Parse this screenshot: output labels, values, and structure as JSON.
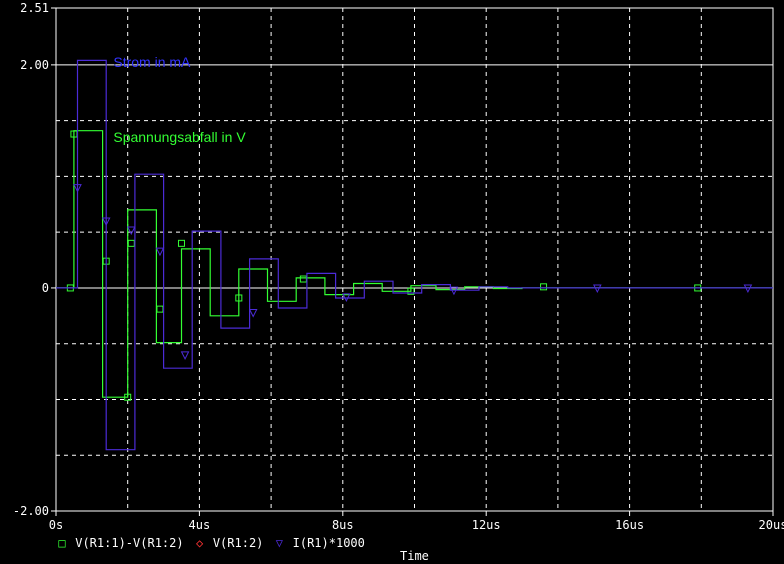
{
  "chart_data": {
    "type": "line",
    "xlabel": "Time",
    "x_unit": "us",
    "xlim": [
      0,
      20
    ],
    "ylim": [
      -2.0,
      2.51
    ],
    "x_ticks": [
      {
        "value": 0,
        "label": "0s"
      },
      {
        "value": 4,
        "label": "4us"
      },
      {
        "value": 8,
        "label": "8us"
      },
      {
        "value": 12,
        "label": "12us"
      },
      {
        "value": 16,
        "label": "16us"
      },
      {
        "value": 20,
        "label": "20us"
      }
    ],
    "y_ticks": [
      {
        "value": 2.51,
        "label": "2.51"
      },
      {
        "value": 2.0,
        "label": "2.00"
      },
      {
        "value": 0,
        "label": "0"
      },
      {
        "value": -2.0,
        "label": "-2.00"
      }
    ],
    "grid": true,
    "background": "#000000",
    "axis_color": "#ffffff",
    "legend_position": "bottom-left",
    "legend": [
      {
        "marker": "□",
        "label": "V(R1:1)-V(R1:2)",
        "color": "#33ff33"
      },
      {
        "marker": "◇",
        "label": "V(R1:2)",
        "color": "#ff3333"
      },
      {
        "marker": "▽",
        "label": "I(R1)*1000",
        "color": "#4b2bd6"
      }
    ],
    "annotations": [
      {
        "text": "Strom in mA",
        "x": 1.6,
        "y": 1.98,
        "color": "#3333ff"
      },
      {
        "text": "Spannungsabfall in V",
        "x": 1.6,
        "y": 1.31,
        "color": "#33ff33"
      }
    ],
    "series": [
      {
        "name": "V(R1:1)-V(R1:2)",
        "color": "#33ff33",
        "marker": "square",
        "x": [
          0,
          0.5,
          0.5,
          1.3,
          1.3,
          2.0,
          2.0,
          2.8,
          2.8,
          3.5,
          3.5,
          4.3,
          4.3,
          5.1,
          5.1,
          5.9,
          5.9,
          6.7,
          6.7,
          7.5,
          7.5,
          8.3,
          8.3,
          9.1,
          9.1,
          9.9,
          9.9,
          10.6,
          10.6,
          11.4,
          11.4,
          12.2,
          12.2,
          13.0,
          13.0,
          20
        ],
        "y": [
          0,
          0,
          1.41,
          1.41,
          -0.98,
          -0.98,
          0.7,
          0.7,
          -0.49,
          -0.49,
          0.35,
          0.35,
          -0.25,
          -0.25,
          0.17,
          0.17,
          -0.12,
          -0.12,
          0.09,
          0.09,
          -0.06,
          -0.06,
          0.04,
          0.04,
          -0.03,
          -0.03,
          0.02,
          0.02,
          -0.015,
          -0.015,
          0.01,
          0.01,
          -0.005,
          -0.005,
          0,
          0
        ],
        "markers_x": [
          0.4,
          0.5,
          1.4,
          2.0,
          2.1,
          2.9,
          3.5,
          5.1,
          6.9,
          9.9,
          13.6,
          17.9
        ],
        "markers_y": [
          0,
          1.38,
          0.24,
          -0.98,
          0.4,
          -0.19,
          0.4,
          -0.09,
          0.08,
          -0.03,
          0.01,
          0
        ]
      },
      {
        "name": "I(R1)*1000",
        "color": "#4b2bd6",
        "marker": "triangle-down",
        "x": [
          0,
          0.6,
          0.6,
          1.4,
          1.4,
          2.2,
          2.2,
          3.0,
          3.0,
          3.8,
          3.8,
          4.6,
          4.6,
          5.4,
          5.4,
          6.2,
          6.2,
          7.0,
          7.0,
          7.8,
          7.8,
          8.6,
          8.6,
          9.4,
          9.4,
          10.2,
          10.2,
          11.0,
          11.0,
          11.8,
          11.8,
          12.6,
          12.6,
          20
        ],
        "y": [
          0,
          0,
          2.04,
          2.04,
          -1.45,
          -1.45,
          1.02,
          1.02,
          -0.72,
          -0.72,
          0.51,
          0.51,
          -0.36,
          -0.36,
          0.26,
          0.26,
          -0.18,
          -0.18,
          0.13,
          0.13,
          -0.09,
          -0.09,
          0.06,
          0.06,
          -0.045,
          -0.045,
          0.03,
          0.03,
          -0.02,
          -0.02,
          0.01,
          0.01,
          0,
          0
        ],
        "markers_x": [
          0.6,
          1.4,
          2.1,
          2.9,
          3.6,
          5.5,
          8.1,
          11.1,
          15.1,
          19.3
        ],
        "markers_y": [
          0.9,
          0.6,
          0.52,
          0.33,
          -0.6,
          -0.22,
          -0.08,
          -0.02,
          0,
          0
        ]
      }
    ]
  }
}
